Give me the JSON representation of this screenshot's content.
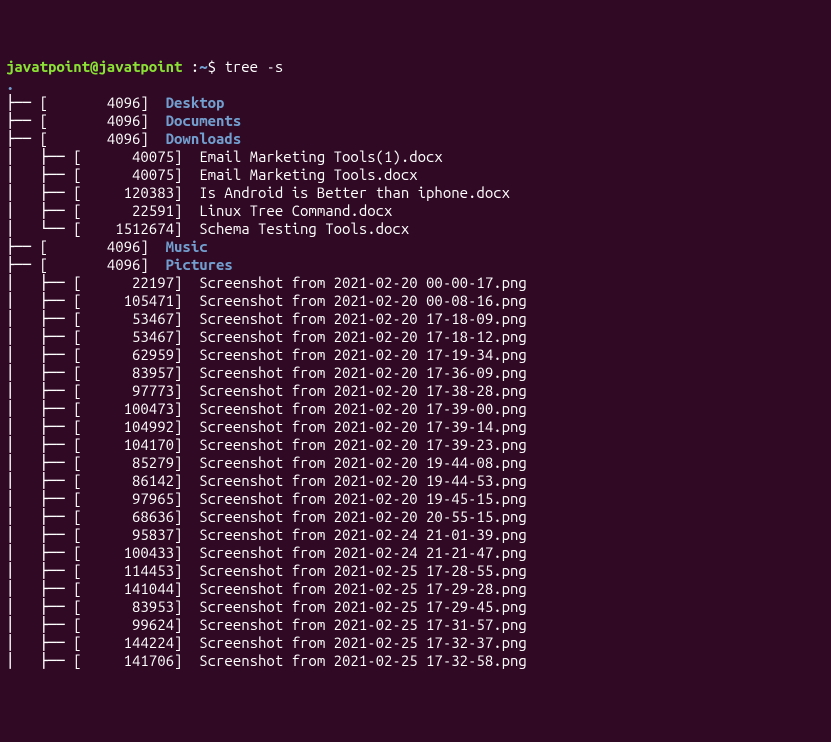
{
  "prompt": {
    "user_host": "javatpoint@javatpoint",
    "separator1": " :",
    "path": "~",
    "separator2": "$ ",
    "command": "tree -s"
  },
  "root": ".",
  "tree": [
    {
      "branch": "├── ",
      "size": "[       4096]  ",
      "name": "Desktop",
      "dir": true
    },
    {
      "branch": "├── ",
      "size": "[       4096]  ",
      "name": "Documents",
      "dir": true
    },
    {
      "branch": "├── ",
      "size": "[       4096]  ",
      "name": "Downloads",
      "dir": true
    },
    {
      "branch": "│   ├── ",
      "size": "[      40075]  ",
      "name": "Email Marketing Tools(1).docx",
      "dir": false
    },
    {
      "branch": "│   ├── ",
      "size": "[      40075]  ",
      "name": "Email Marketing Tools.docx",
      "dir": false
    },
    {
      "branch": "│   ├── ",
      "size": "[     120383]  ",
      "name": "Is Android is Better than iphone.docx",
      "dir": false
    },
    {
      "branch": "│   ├── ",
      "size": "[      22591]  ",
      "name": "Linux Tree Command.docx",
      "dir": false
    },
    {
      "branch": "│   └── ",
      "size": "[    1512674]  ",
      "name": "Schema Testing Tools.docx",
      "dir": false
    },
    {
      "branch": "├── ",
      "size": "[       4096]  ",
      "name": "Music",
      "dir": true
    },
    {
      "branch": "├── ",
      "size": "[       4096]  ",
      "name": "Pictures",
      "dir": true
    },
    {
      "branch": "│   ├── ",
      "size": "[      22197]  ",
      "name": "Screenshot from 2021-02-20 00-00-17.png",
      "dir": false
    },
    {
      "branch": "│   ├── ",
      "size": "[     105471]  ",
      "name": "Screenshot from 2021-02-20 00-08-16.png",
      "dir": false
    },
    {
      "branch": "│   ├── ",
      "size": "[      53467]  ",
      "name": "Screenshot from 2021-02-20 17-18-09.png",
      "dir": false
    },
    {
      "branch": "│   ├── ",
      "size": "[      53467]  ",
      "name": "Screenshot from 2021-02-20 17-18-12.png",
      "dir": false
    },
    {
      "branch": "│   ├── ",
      "size": "[      62959]  ",
      "name": "Screenshot from 2021-02-20 17-19-34.png",
      "dir": false
    },
    {
      "branch": "│   ├── ",
      "size": "[      83957]  ",
      "name": "Screenshot from 2021-02-20 17-36-09.png",
      "dir": false
    },
    {
      "branch": "│   ├── ",
      "size": "[      97773]  ",
      "name": "Screenshot from 2021-02-20 17-38-28.png",
      "dir": false
    },
    {
      "branch": "│   ├── ",
      "size": "[     100473]  ",
      "name": "Screenshot from 2021-02-20 17-39-00.png",
      "dir": false
    },
    {
      "branch": "│   ├── ",
      "size": "[     104992]  ",
      "name": "Screenshot from 2021-02-20 17-39-14.png",
      "dir": false
    },
    {
      "branch": "│   ├── ",
      "size": "[     104170]  ",
      "name": "Screenshot from 2021-02-20 17-39-23.png",
      "dir": false
    },
    {
      "branch": "│   ├── ",
      "size": "[      85279]  ",
      "name": "Screenshot from 2021-02-20 19-44-08.png",
      "dir": false
    },
    {
      "branch": "│   ├── ",
      "size": "[      86142]  ",
      "name": "Screenshot from 2021-02-20 19-44-53.png",
      "dir": false
    },
    {
      "branch": "│   ├── ",
      "size": "[      97965]  ",
      "name": "Screenshot from 2021-02-20 19-45-15.png",
      "dir": false
    },
    {
      "branch": "│   ├── ",
      "size": "[      68636]  ",
      "name": "Screenshot from 2021-02-20 20-55-15.png",
      "dir": false
    },
    {
      "branch": "│   ├── ",
      "size": "[      95837]  ",
      "name": "Screenshot from 2021-02-24 21-01-39.png",
      "dir": false
    },
    {
      "branch": "│   ├── ",
      "size": "[     100433]  ",
      "name": "Screenshot from 2021-02-24 21-21-47.png",
      "dir": false
    },
    {
      "branch": "│   ├── ",
      "size": "[     114453]  ",
      "name": "Screenshot from 2021-02-25 17-28-55.png",
      "dir": false
    },
    {
      "branch": "│   ├── ",
      "size": "[     141044]  ",
      "name": "Screenshot from 2021-02-25 17-29-28.png",
      "dir": false
    },
    {
      "branch": "│   ├── ",
      "size": "[      83953]  ",
      "name": "Screenshot from 2021-02-25 17-29-45.png",
      "dir": false
    },
    {
      "branch": "│   ├── ",
      "size": "[      99624]  ",
      "name": "Screenshot from 2021-02-25 17-31-57.png",
      "dir": false
    },
    {
      "branch": "│   ├── ",
      "size": "[     144224]  ",
      "name": "Screenshot from 2021-02-25 17-32-37.png",
      "dir": false
    },
    {
      "branch": "│   ├── ",
      "size": "[     141706]  ",
      "name": "Screenshot from 2021-02-25 17-32-58.png",
      "dir": false
    }
  ]
}
